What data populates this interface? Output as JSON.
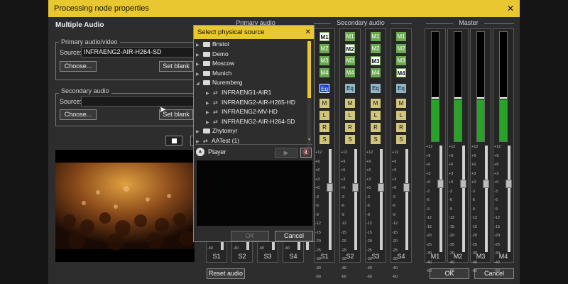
{
  "window": {
    "title": "Processing node properties",
    "close": "✕"
  },
  "multi": {
    "heading": "Multiple Audio"
  },
  "primary": {
    "group_label": "Primary audio/video",
    "source_label": "Source:",
    "source_value": "INFRAENG2-AIR-H264-SD",
    "choose": "Choose...",
    "set_blank": "Set blank"
  },
  "secondary": {
    "group_label": "Secondary audio",
    "source_label": "Source:",
    "source_value": "",
    "choose": "Choose...",
    "set_blank": "Set blank"
  },
  "sections": {
    "primary": "Primary audio",
    "secondary": "Secondary audio",
    "master": "Master"
  },
  "scale": [
    "+12",
    "+9",
    "+6",
    "+3",
    "+0",
    "-3",
    "-6",
    "-9",
    "-12",
    "-15",
    "-20",
    "-25",
    "-30",
    "-40",
    "-60"
  ],
  "primary_channels": [
    "S1",
    "S2",
    "S3",
    "S4"
  ],
  "secondary_strips": [
    {
      "m": [
        "M1",
        "M2",
        "M3",
        "M4"
      ],
      "active": 0,
      "eq_active": true,
      "channel": "S1"
    },
    {
      "m": [
        "M1",
        "M2",
        "M3",
        "M4"
      ],
      "active": 1,
      "eq_active": false,
      "channel": "S2"
    },
    {
      "m": [
        "M1",
        "M2",
        "M3",
        "M4"
      ],
      "active": 2,
      "eq_active": false,
      "channel": "S3"
    },
    {
      "m": [
        "M1",
        "M2",
        "M3",
        "M4"
      ],
      "active": 3,
      "eq_active": false,
      "channel": "S4"
    }
  ],
  "strip_buttons": {
    "eq": "Eq",
    "m": "M",
    "l": "L",
    "r": "R",
    "s": "S"
  },
  "master_channels": [
    "M1",
    "M2",
    "M3",
    "M4"
  ],
  "master_level": 0.38,
  "buttons": {
    "reset_audio": "Reset audio",
    "ok": "OK",
    "cancel": "Cancel"
  },
  "dialog": {
    "title": "Select physical source",
    "close": "✕",
    "tree": [
      {
        "label": "Bristol",
        "kind": "folder",
        "indent": 0,
        "expanded": false
      },
      {
        "label": "Demo",
        "kind": "folder",
        "indent": 0,
        "expanded": false
      },
      {
        "label": "Moscow",
        "kind": "folder",
        "indent": 0,
        "expanded": false
      },
      {
        "label": "Munich",
        "kind": "folder",
        "indent": 0,
        "expanded": false
      },
      {
        "label": "Nuremberg",
        "kind": "folder",
        "indent": 0,
        "expanded": true
      },
      {
        "label": "INFRAENG1-AIR1",
        "kind": "source",
        "indent": 1,
        "expanded": false
      },
      {
        "label": "INFRAENG2-AIR-H265-HD",
        "kind": "source",
        "indent": 1,
        "expanded": false
      },
      {
        "label": "INFRAENG2-MV-HD",
        "kind": "source",
        "indent": 1,
        "expanded": false
      },
      {
        "label": "INFRAENG2-AIR-H264-SD",
        "kind": "source",
        "indent": 1,
        "expanded": false
      },
      {
        "label": "Zhytomyr",
        "kind": "folder",
        "indent": 0,
        "expanded": false
      },
      {
        "label": "AATest (1)",
        "kind": "source",
        "indent": 0,
        "expanded": false
      }
    ],
    "player_label": "Player",
    "ok": "OK",
    "cancel": "Cancel"
  },
  "colors": {
    "accent": "#e8c730",
    "meter": "#27a327",
    "eq_active": "#1a3ecf"
  }
}
